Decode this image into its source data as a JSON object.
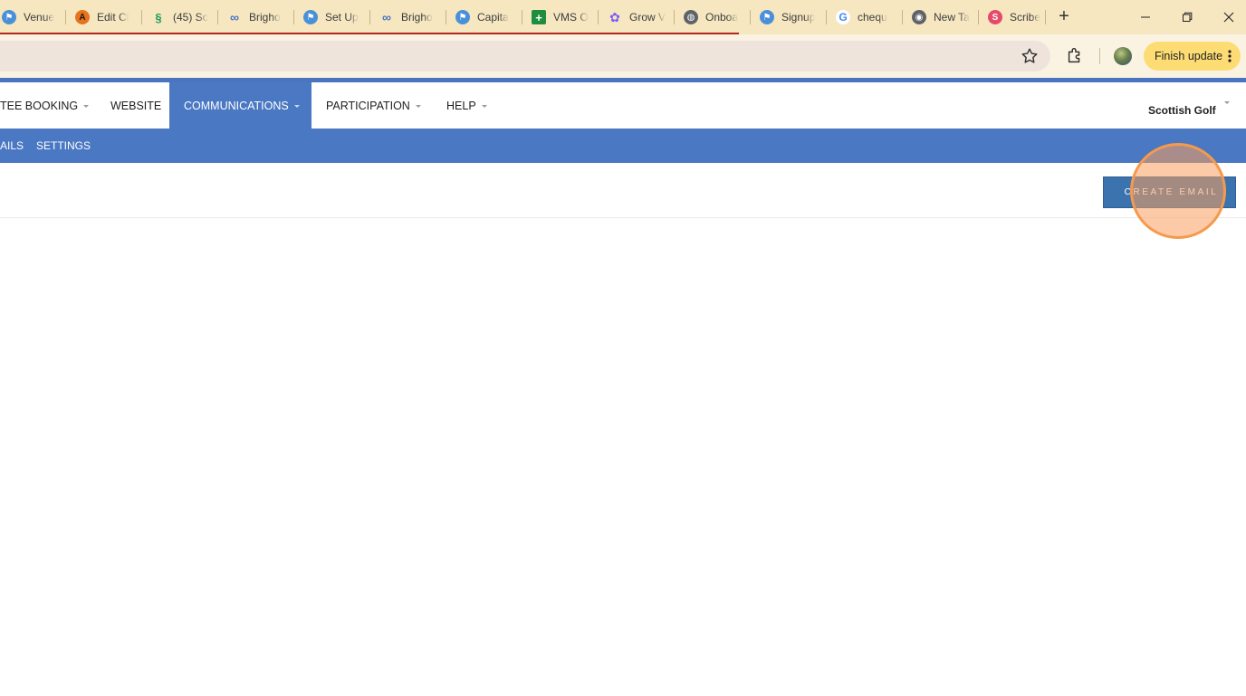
{
  "browser": {
    "tabs": [
      {
        "title": "Venue",
        "icon": "golf-flag-icon",
        "color": "#4a90d9"
      },
      {
        "title": "Edit Cl",
        "icon": "a-logo-icon",
        "color": "#e8731d"
      },
      {
        "title": "(45) Sc",
        "icon": "link-icon",
        "color": "#1f9a5b"
      },
      {
        "title": "Brigho",
        "icon": "link-icon",
        "color": "#4a74c0"
      },
      {
        "title": "Set Up",
        "icon": "golf-flag-icon",
        "color": "#4a90d9"
      },
      {
        "title": "Brigho",
        "icon": "link-icon",
        "color": "#4a74c0"
      },
      {
        "title": "Capita",
        "icon": "golf-flag-icon",
        "color": "#4a90d9"
      },
      {
        "title": "VMS O",
        "icon": "sheets-plus-icon",
        "color": "#1e8e3e"
      },
      {
        "title": "Grow V",
        "icon": "flower-icon",
        "color": "#7a5af8"
      },
      {
        "title": "Onboa",
        "icon": "globe-icon",
        "color": "#5f6368"
      },
      {
        "title": "Signup",
        "icon": "golf-flag-icon",
        "color": "#4a90d9"
      },
      {
        "title": "chequ",
        "icon": "google-g-icon",
        "color": "#4285f4"
      },
      {
        "title": "New Ta",
        "icon": "chrome-icon",
        "color": "#5f6368"
      },
      {
        "title": "Scribe",
        "icon": "scribe-icon",
        "color": "#e64a6b"
      }
    ],
    "new_tab_symbol": "+",
    "finish_update_label": "Finish update"
  },
  "nav": {
    "items": [
      {
        "label": "TEE BOOKING",
        "has_caret": true,
        "active": false
      },
      {
        "label": "WEBSITE",
        "has_caret": false,
        "active": false
      },
      {
        "label": "COMMUNICATIONS",
        "has_caret": true,
        "active": true
      },
      {
        "label": "PARTICIPATION",
        "has_caret": true,
        "active": false
      },
      {
        "label": "HELP",
        "has_caret": true,
        "active": false
      }
    ],
    "org_name": "Scottish Golf"
  },
  "subnav": {
    "items": [
      "AILS",
      "SETTINGS"
    ]
  },
  "actions": {
    "create_email_label": "CREATE EMAIL"
  },
  "colors": {
    "brand_blue": "#4a78c2",
    "button_blue": "#3b73ae",
    "highlight_orange": "#f59a4d",
    "tabstrip_bg": "#f6e7c1",
    "finish_update_bg": "#fddc74"
  }
}
